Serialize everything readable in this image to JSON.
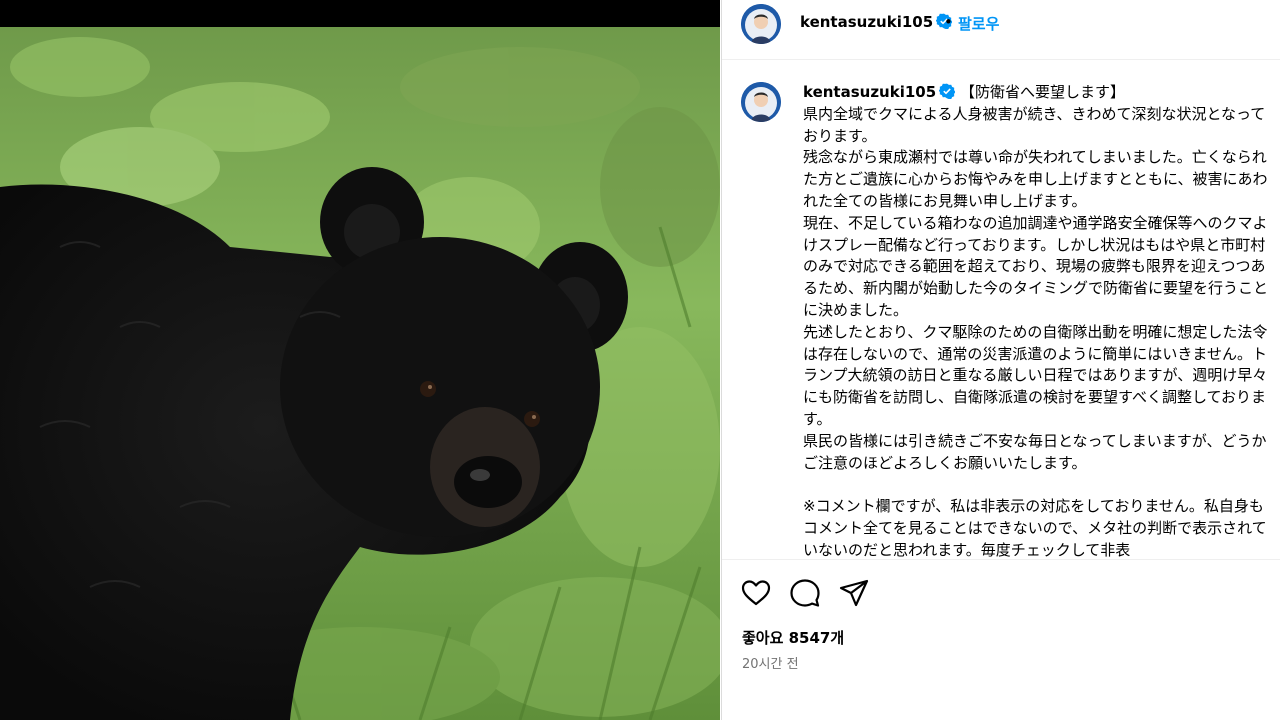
{
  "photo": {
    "alt_subject": "bear-photo"
  },
  "header": {
    "username": "kentasuzuki105",
    "separator": "•",
    "follow_label": "팔로우"
  },
  "caption": {
    "username": "kentasuzuki105",
    "text": "【防衛省へ要望します】\n県内全域でクマによる人身被害が続き、きわめて深刻な状況となっております。\n残念ながら東成瀬村では尊い命が失われてしまいました。亡くなられた方とご遺族に心からお悔やみを申し上げますとともに、被害にあわれた全ての皆様にお見舞い申し上げます。\n現在、不足している箱わなの追加調達や通学路安全確保等へのクマよけスプレー配備など行っております。しかし状況はもはや県と市町村のみで対応できる範囲を超えており、現場の疲弊も限界を迎えつつあるため、新内閣が始動した今のタイミングで防衛省に要望を行うことに決めました。\n先述したとおり、クマ駆除のための自衛隊出動を明確に想定した法令は存在しないので、通常の災害派遣のように簡単にはいきません。トランプ大統領の訪日と重なる厳しい日程ではありますが、週明け早々にも防衛省を訪問し、自衛隊派遣の検討を要望すべく調整しております。\n県民の皆様には引き続きご不安な毎日となってしまいますが、どうかご注意のほどよろしくお願いいたします。\n\n※コメント欄ですが、私は非表示の対応をしておりません。私自身もコメント全てを見ることはできないので、メタ社の判断で表示されていないのだと思われます。毎度チェックして非表"
  },
  "actions": {
    "like_icon": "heart-icon",
    "comment_icon": "comment-icon",
    "share_icon": "send-icon"
  },
  "likes_text": "좋아요 8547개",
  "time_text": "20시간 전",
  "colors": {
    "accent": "#0095f6",
    "verified": "#0095f6",
    "muted": "#737373"
  }
}
